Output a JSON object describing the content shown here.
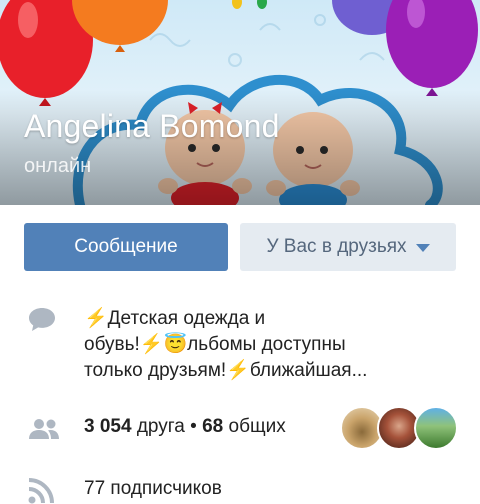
{
  "profile": {
    "name": "Angelina Bomond",
    "status": "онлайн"
  },
  "actions": {
    "message_label": "Сообщение",
    "friends_label": "У Вас в друзьях"
  },
  "about": {
    "line1": "Детская одежда и",
    "line2a": "обувь!",
    "line2b": "льбомы доступны",
    "line3a": "только друзьям!",
    "line3b": "ближайшая..."
  },
  "friends": {
    "count": "3 054",
    "count_label": "друга",
    "separator": "•",
    "mutual": "68",
    "mutual_label": "общих"
  },
  "subscribers": {
    "text": "77 подписчиков"
  },
  "colors": {
    "accent": "#5181b8",
    "secondary_button": "#e5ebf1",
    "icon_gray": "#aeb7c2"
  },
  "icons": {
    "about": "speech-bubble-icon",
    "friends": "people-icon",
    "subscribers": "rss-icon"
  }
}
